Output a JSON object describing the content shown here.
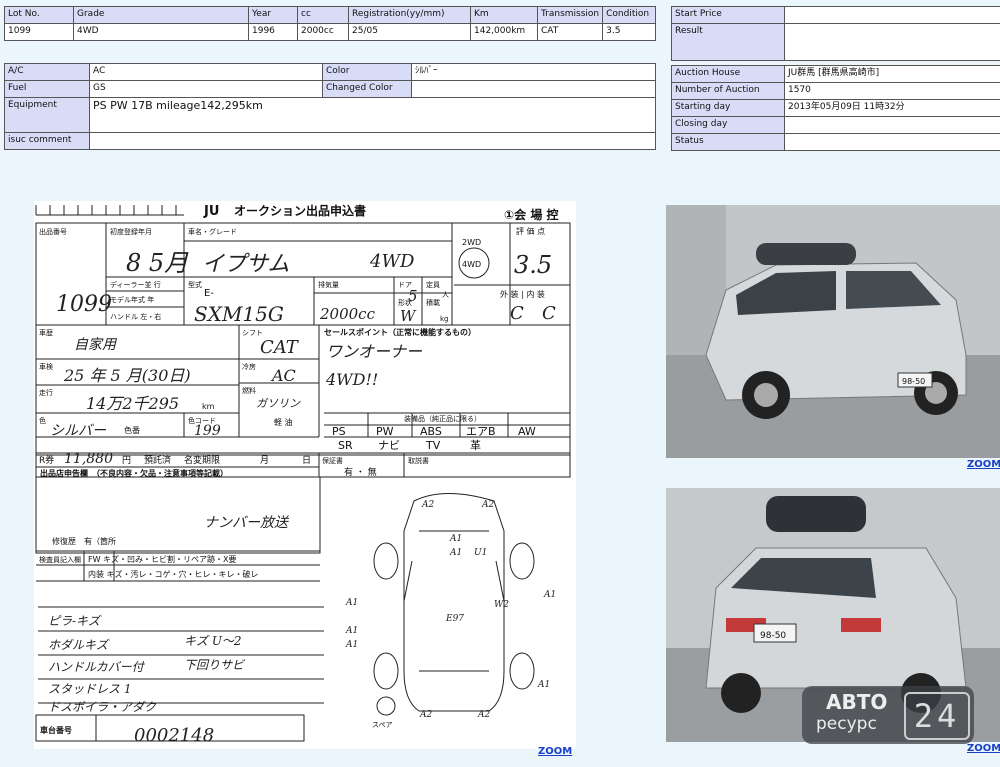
{
  "lot_table": {
    "headers": [
      "Lot No.",
      "Grade",
      "Year",
      "cc",
      "Registration(yy/mm)",
      "Km",
      "Transmission",
      "Condition"
    ],
    "values": [
      "1099",
      "4WD",
      "1996",
      "2000cc",
      "25/05",
      "142,000km",
      "CAT",
      "3.5"
    ]
  },
  "spec_table": {
    "ac_label": "A/C",
    "ac_value": "AC",
    "color_label": "Color",
    "color_value": "ｼﾙﾊﾞｰ",
    "fuel_label": "Fuel",
    "fuel_value": "GS",
    "changed_color_label": "Changed Color",
    "changed_color_value": "",
    "equipment_label": "Equipment",
    "equipment_value": "PS PW 17B  mileage142,295km",
    "isuc_label": "isuc comment",
    "isuc_value": ""
  },
  "auction_table": {
    "rows": [
      {
        "label": "Start Price",
        "value": ""
      },
      {
        "label": "Result",
        "value": ""
      },
      {
        "label": "Auction House",
        "value": "JU群馬 [群馬県高崎市]"
      },
      {
        "label": "Number of Auction",
        "value": "1570"
      },
      {
        "label": "Starting day",
        "value": "2013年05月09日 11時32分"
      },
      {
        "label": "Closing day",
        "value": ""
      },
      {
        "label": "Status",
        "value": ""
      }
    ]
  },
  "sheet": {
    "title": "オークション出品申込書",
    "logo": "JU",
    "venue": "①会 場 控",
    "lot_label": "出品番号",
    "lot_hand": "1099",
    "first_reg_label": "初度登録年月",
    "first_reg_hand": "8 5月",
    "model_label": "車名・グレード",
    "model_hand": "イプサム",
    "grade_hand": "4WD",
    "drive_2wd": "2WD",
    "drive_4wd": "4WD",
    "score_label": "評 価 点",
    "score_hand": "3.5",
    "dealer_label": "ディーラー並 行",
    "model_type_label": "モデル年式 年",
    "handle_label": "ハンドル 左・右",
    "type_label": "型式",
    "type_prefix": "E-",
    "type_hand": "SXM15G",
    "displacement_label": "排気量",
    "displacement_hand": "2000cc",
    "door_label": "ドア",
    "door_hand": "5",
    "capacity_label": "定員",
    "capacity_unit": "人",
    "shape_label": "形状",
    "shape_hand": "W",
    "load_label": "積載",
    "load_unit": "kg",
    "ext_int_label": "外 装 | 内 装",
    "ext_hand": "C",
    "int_hand": "C",
    "history_label": "車歴",
    "history_hand": "自家用",
    "shift_label": "シフト",
    "shift_hand": "CAT",
    "sales_points_label": "セールスポイント（正常に機能するもの）",
    "sales_point_1": "ワンオーナー",
    "sales_point_2": "4WD!!",
    "inspection_label": "車検",
    "inspection_hand": "25 年 5 月(30日)",
    "cooling_label": "冷房",
    "cooling_hand": "AC",
    "mileage_label": "走行",
    "mileage_hand": "14万2千295",
    "mileage_unit": "km",
    "fuel_label": "燃料",
    "fuel_hand": "ガソリン",
    "oil_label": "軽 油",
    "color_label": "色",
    "color_hand": "シルバー",
    "color_no_label": "色番",
    "color_code_label": "色コード",
    "color_code_hand": "199",
    "equipment_opts": [
      "PS",
      "PW",
      "ABS",
      "エアB",
      "AW",
      "SR",
      "ナビ",
      "TV",
      "革"
    ],
    "equip_row_label": "装備品（純正品に限る）",
    "recycle_label": "R券",
    "recycle_hand": "11,880",
    "recycle_unit": "円",
    "deposit_label": "預託済",
    "rename_label": "名変期限",
    "month_label": "月",
    "day_label": "日",
    "warranty_label": "保証書",
    "warranty_opts": "有 ・ 無",
    "manual_label": "取説書",
    "dealer_notes_label": "出品店申告欄　（不良内容・欠品・注意事項等記載）",
    "dealer_notes_hand": "ナンバー放送",
    "repair_label": "修復歴　有（箇所",
    "inspector_label": "検査員記入欄",
    "fw_row": "FW キズ・凹み・ヒビ割・リペア跡・X要",
    "interior_row": "内装 キズ・汚レ・コゲ・穴・ヒレ・キレ・破レ",
    "notes_hand": [
      "ピラ-キズ",
      "ホダルキズ",
      "ハンドルカバー付",
      "スタッドレス 1",
      "ドスボイラ・アダク"
    ],
    "notes_hand_right": [
      "キズ U～2",
      "下回りサビ"
    ],
    "chassis_label": "車台番号",
    "chassis_hand": "0002148",
    "spare_label": "スペア",
    "diagram_marks": [
      "A2",
      "A2",
      "A1",
      "A1",
      "U1",
      "E97",
      "A1",
      "A1",
      "A1",
      "A1",
      "A2",
      "A2",
      "A1",
      "W2"
    ]
  },
  "zoom_labels": [
    "ZOOM",
    "ZOOM",
    "ZOOM"
  ],
  "photo1": {
    "plate": "98-50"
  },
  "photo2": {
    "plate": "98-50"
  },
  "watermark": {
    "line1": "АВТО",
    "line2": "ресурс",
    "number": "24"
  }
}
